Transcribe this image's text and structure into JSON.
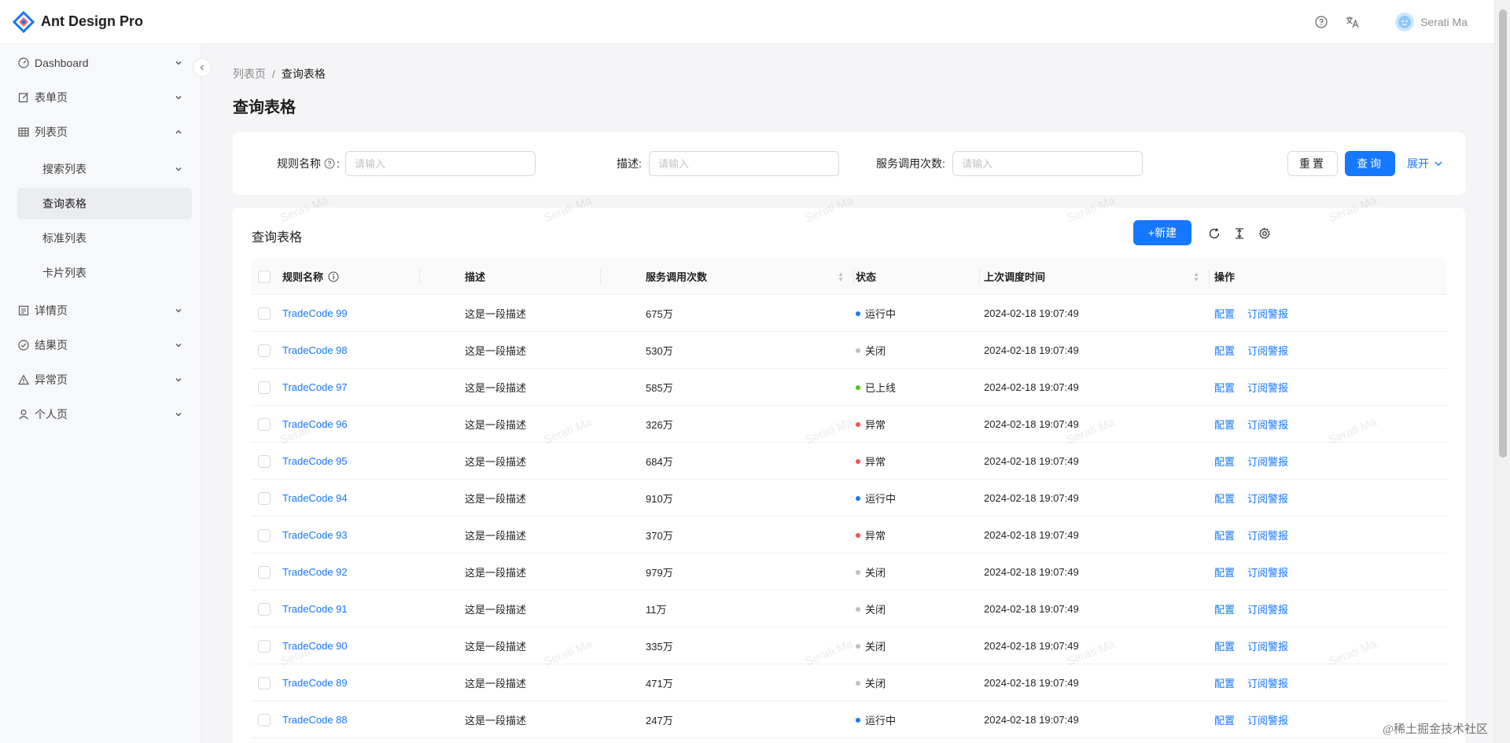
{
  "header": {
    "app_title": "Ant Design Pro",
    "username": "Serati Ma"
  },
  "sidebar": {
    "items": [
      {
        "label": "Dashboard",
        "icon": "dashboard-icon"
      },
      {
        "label": "表单页",
        "icon": "form-icon"
      },
      {
        "label": "列表页",
        "icon": "table-icon"
      },
      {
        "label": "详情页",
        "icon": "profile-icon"
      },
      {
        "label": "结果页",
        "icon": "check-circle-icon"
      },
      {
        "label": "异常页",
        "icon": "warning-icon"
      },
      {
        "label": "个人页",
        "icon": "user-icon"
      }
    ],
    "subitems": [
      {
        "label": "搜索列表"
      },
      {
        "label": "查询表格"
      },
      {
        "label": "标准列表"
      },
      {
        "label": "卡片列表"
      }
    ]
  },
  "breadcrumb": {
    "parent": "列表页",
    "separator": "/",
    "current": "查询表格"
  },
  "page_title": "查询表格",
  "search": {
    "rule_name_label": "规则名称",
    "desc_label": "描述:",
    "calls_label": "服务调用次数:",
    "placeholder": "请输入",
    "reset_label": "重置",
    "query_label": "查询",
    "expand_label": "展开"
  },
  "table": {
    "title": "查询表格",
    "new_label": "新建",
    "columns": {
      "name": "规则名称",
      "desc": "描述",
      "calls": "服务调用次数",
      "status": "状态",
      "time": "上次调度时间",
      "ops": "操作"
    },
    "op_config": "配置",
    "op_subscribe": "订阅警报",
    "rows": [
      {
        "name": "TradeCode 99",
        "desc": "这是一段描述",
        "calls": "675万",
        "status": "运行中",
        "status_color": "#1677ff",
        "time": "2024-02-18 19:07:49"
      },
      {
        "name": "TradeCode 98",
        "desc": "这是一段描述",
        "calls": "530万",
        "status": "关闭",
        "status_color": "#bfbfbf",
        "time": "2024-02-18 19:07:49"
      },
      {
        "name": "TradeCode 97",
        "desc": "这是一段描述",
        "calls": "585万",
        "status": "已上线",
        "status_color": "#52c41a",
        "time": "2024-02-18 19:07:49"
      },
      {
        "name": "TradeCode 96",
        "desc": "这是一段描述",
        "calls": "326万",
        "status": "异常",
        "status_color": "#ff4d4f",
        "time": "2024-02-18 19:07:49"
      },
      {
        "name": "TradeCode 95",
        "desc": "这是一段描述",
        "calls": "684万",
        "status": "异常",
        "status_color": "#ff4d4f",
        "time": "2024-02-18 19:07:49"
      },
      {
        "name": "TradeCode 94",
        "desc": "这是一段描述",
        "calls": "910万",
        "status": "运行中",
        "status_color": "#1677ff",
        "time": "2024-02-18 19:07:49"
      },
      {
        "name": "TradeCode 93",
        "desc": "这是一段描述",
        "calls": "370万",
        "status": "异常",
        "status_color": "#ff4d4f",
        "time": "2024-02-18 19:07:49"
      },
      {
        "name": "TradeCode 92",
        "desc": "这是一段描述",
        "calls": "979万",
        "status": "关闭",
        "status_color": "#bfbfbf",
        "time": "2024-02-18 19:07:49"
      },
      {
        "name": "TradeCode 91",
        "desc": "这是一段描述",
        "calls": "11万",
        "status": "关闭",
        "status_color": "#bfbfbf",
        "time": "2024-02-18 19:07:49"
      },
      {
        "name": "TradeCode 90",
        "desc": "这是一段描述",
        "calls": "335万",
        "status": "关闭",
        "status_color": "#bfbfbf",
        "time": "2024-02-18 19:07:49"
      },
      {
        "name": "TradeCode 89",
        "desc": "这是一段描述",
        "calls": "471万",
        "status": "关闭",
        "status_color": "#bfbfbf",
        "time": "2024-02-18 19:07:49"
      },
      {
        "name": "TradeCode 88",
        "desc": "这是一段描述",
        "calls": "247万",
        "status": "运行中",
        "status_color": "#1677ff",
        "time": "2024-02-18 19:07:49"
      }
    ]
  },
  "watermark_text": "Serati Ma",
  "corner_mark": "@稀土掘金技术社区",
  "accent_color": "#1677ff"
}
